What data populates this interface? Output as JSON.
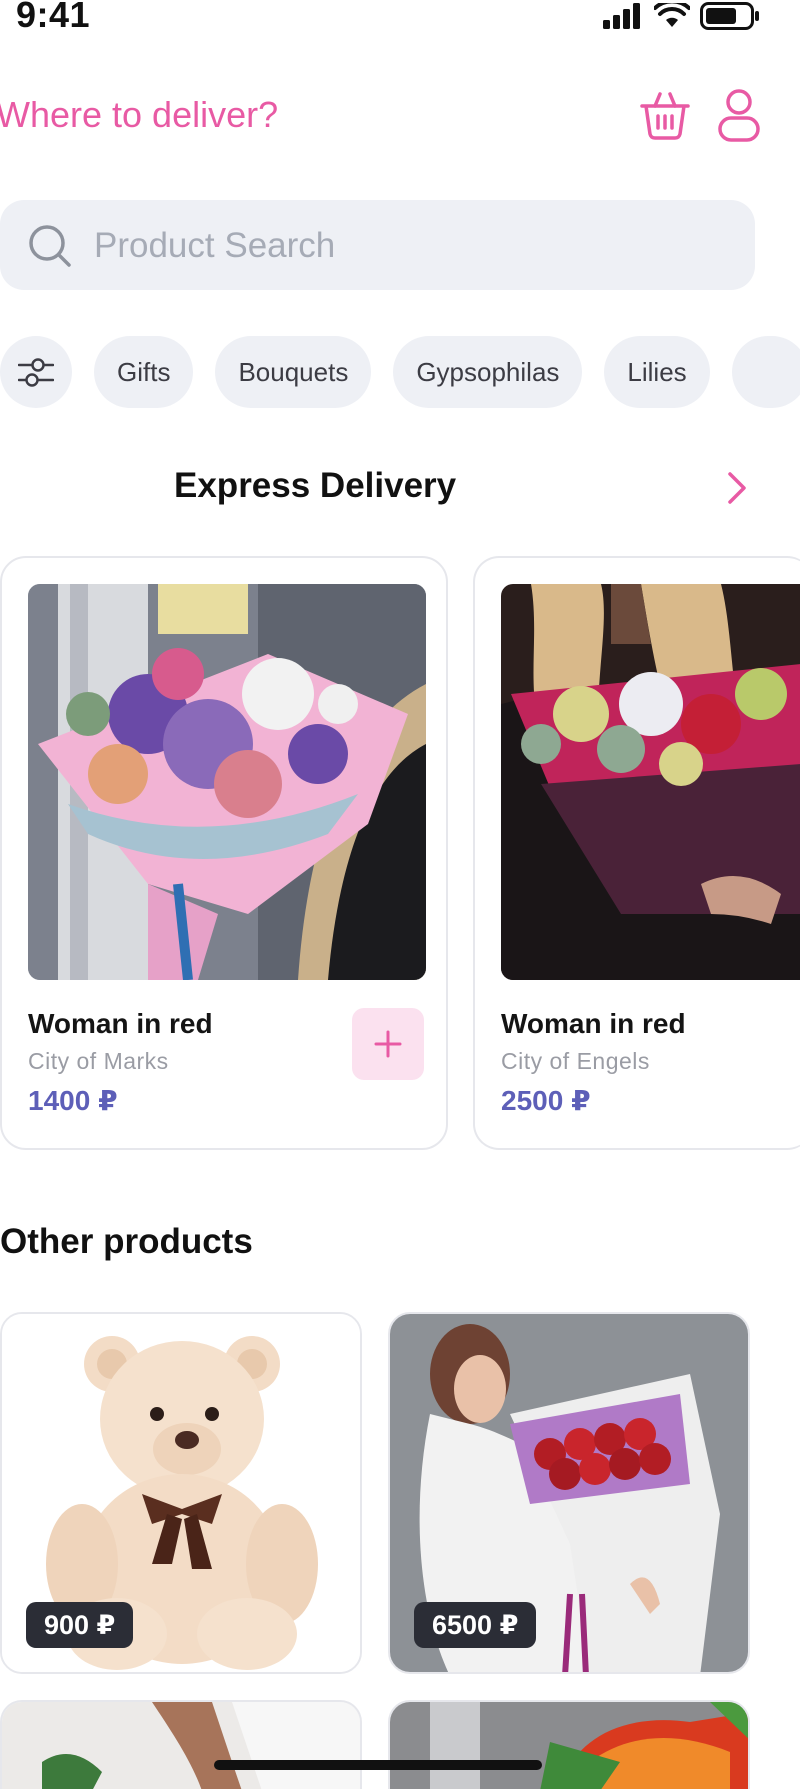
{
  "status_bar": {
    "time": "9:41"
  },
  "header": {
    "title": "Where to deliver?",
    "icons": [
      "basket-icon",
      "user-icon"
    ]
  },
  "search": {
    "placeholder": "Product Search"
  },
  "chips": [
    "Gifts",
    "Bouquets",
    "Gypsophilas",
    "Lilies"
  ],
  "express": {
    "title": "Express Delivery",
    "items": [
      {
        "name": "Woman in red",
        "city": "City of Marks",
        "price": "1400 ₽"
      },
      {
        "name": "Woman in red",
        "city": "City of Engels",
        "price": "2500 ₽"
      }
    ]
  },
  "other": {
    "title": "Other products",
    "items": [
      {
        "price": "900 ₽"
      },
      {
        "price": "6500 ₽"
      }
    ]
  },
  "colors": {
    "accent": "#e85aa4",
    "price": "#5d5fb8",
    "chip_bg": "#eef0f5"
  }
}
